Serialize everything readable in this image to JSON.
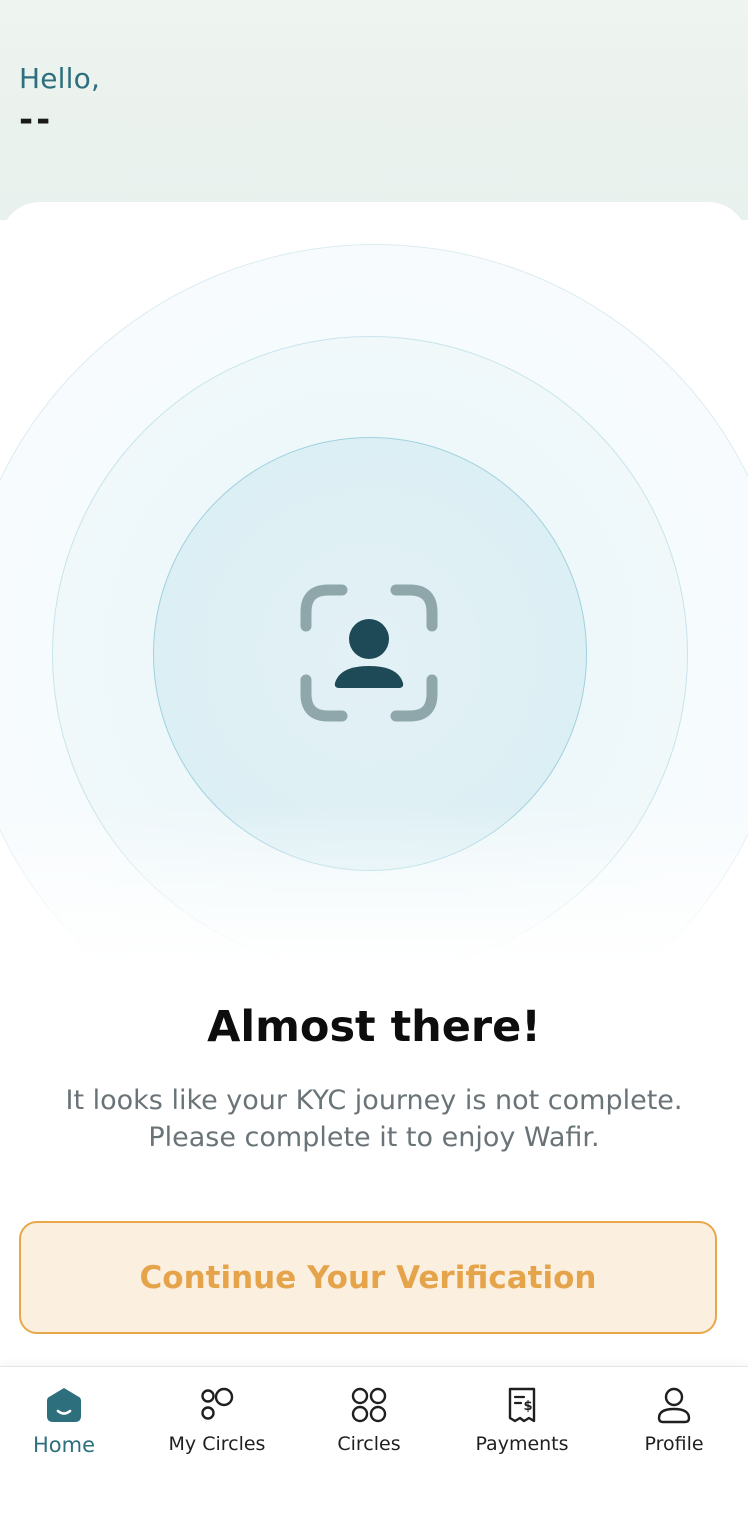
{
  "header": {
    "greeting": "Hello,",
    "username": "--"
  },
  "kyc": {
    "icon": "face-scan-icon",
    "title": "Almost there!",
    "message_line1": "It looks like your KYC journey is not complete.",
    "message_line2": "Please complete it to enjoy Wafir.",
    "cta_label": "Continue Your Verification"
  },
  "nav": {
    "items": [
      {
        "label": "Home",
        "icon": "home-icon",
        "active": true
      },
      {
        "label": "My Circles",
        "icon": "my-circles-icon",
        "active": false
      },
      {
        "label": "Circles",
        "icon": "circles-icon",
        "active": false
      },
      {
        "label": "Payments",
        "icon": "payments-receipt-icon",
        "active": false
      },
      {
        "label": "Profile",
        "icon": "profile-icon",
        "active": false
      }
    ]
  },
  "colors": {
    "accent": "#2e6f7e",
    "cta_text": "#e6a44a",
    "cta_border": "#e8a84a",
    "cta_bg": "#fbefdf",
    "icon_dark": "#1e4a57",
    "icon_frame": "#8fa7ab"
  }
}
